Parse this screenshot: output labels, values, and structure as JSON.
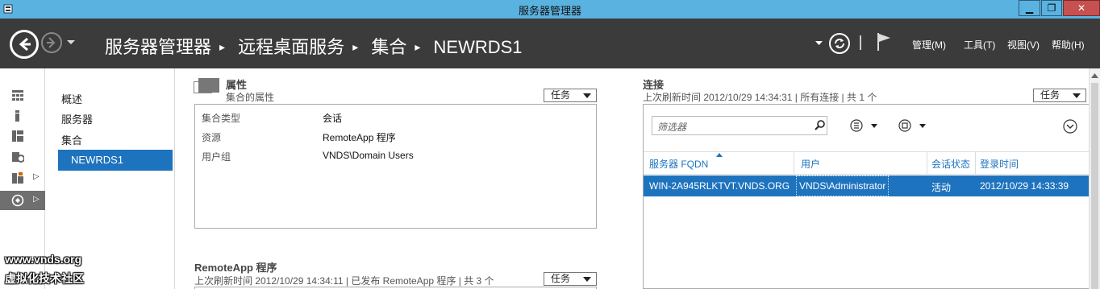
{
  "window": {
    "title": "服务器管理器",
    "minimize": "▁",
    "restore": "❐",
    "close": "✕"
  },
  "navbar": {
    "breadcrumb": [
      "服务器管理器",
      "远程桌面服务",
      "集合",
      "NEWRDS1"
    ],
    "menus": {
      "manage": "管理(M)",
      "tools": "工具(T)",
      "view": "视图(V)",
      "help": "帮助(H)"
    }
  },
  "subnav": {
    "items": [
      "概述",
      "服务器",
      "集合",
      "NEWRDS1"
    ]
  },
  "properties": {
    "title": "属性",
    "subtitle": "集合的属性",
    "task_label": "任务",
    "rows": [
      {
        "label": "集合类型",
        "value": "会话"
      },
      {
        "label": "资源",
        "value": "RemoteApp 程序"
      },
      {
        "label": "用户组",
        "value": "VNDS\\Domain Users"
      }
    ]
  },
  "remoteapp": {
    "title": "RemoteApp 程序",
    "subtitle": "上次刷新时间 2012/10/29 14:34:11 | 已发布 RemoteApp 程序 | 共 3 个",
    "task_label": "任务"
  },
  "connections": {
    "title": "连接",
    "subtitle": "上次刷新时间 2012/10/29 14:34:31 | 所有连接 | 共 1 个",
    "task_label": "任务",
    "filter_placeholder": "筛选器",
    "columns": [
      "服务器 FQDN",
      "用户",
      "会话状态",
      "登录时间"
    ],
    "rows": [
      {
        "server": "WIN-2A945RLKTVT.VNDS.ORG",
        "user": "VNDS\\Administrator",
        "state": "活动",
        "login": "2012/10/29 14:33:39"
      }
    ]
  },
  "watermark": {
    "line1": "www.vnds.org",
    "line2": "虚拟化技术社区"
  }
}
